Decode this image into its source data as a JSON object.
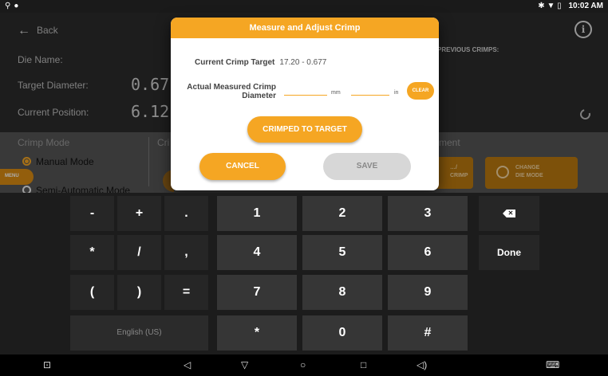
{
  "status_bar": {
    "left_icons": [
      "usb-icon",
      "location-icon"
    ],
    "right_icons": [
      "bluetooth-icon",
      "wifi-icon",
      "battery-icon"
    ],
    "time": "10:02 AM"
  },
  "app": {
    "back_label": "Back",
    "die_name_label": "Die Name:",
    "target_diameter_label": "Target Diameter:",
    "target_diameter_value": "0.67",
    "current_position_label": "Current Position:",
    "current_position_value": "6.12",
    "previous_crimps_label": "PREVIOUS CRIMPS:",
    "crimp_mode_title": "Crimp Mode",
    "manual_mode_label": "Manual Mode",
    "semi_auto_mode_label": "Semi-Automatic Mode",
    "menu_tab_label": "MENU",
    "partial_cri_label": "Cri",
    "partial_ment_label": "ment",
    "partial_crimp_button": "…/ \nCRIMP",
    "change_die_mode_button": "CHANGE\nDIE MODE"
  },
  "dialog": {
    "title": "Measure and Adjust Crimp",
    "current_target_label": "Current Crimp Target",
    "current_target_value": "17.20  -  0.677",
    "actual_measured_label": "Actual Measured Crimp Diameter",
    "mm_unit": "mm",
    "in_unit": "in",
    "mm_value": "",
    "in_value": "",
    "clear_label": "CLEAR",
    "crimped_to_target_label": "CRIMPED TO TARGET",
    "cancel_label": "CANCEL",
    "save_label": "SAVE"
  },
  "keyboard": {
    "row1": [
      "-",
      "+",
      ".",
      "1",
      "2",
      "3"
    ],
    "row2": [
      "*",
      "/",
      ",",
      "4",
      "5",
      "6",
      "Done"
    ],
    "row3": [
      "(",
      ")",
      "=",
      "7",
      "8",
      "9"
    ],
    "row4": [
      "English (US)",
      "*",
      "0",
      "#"
    ]
  },
  "navbar": {
    "icons": [
      "screenshot-icon",
      "volume-down-icon",
      "back-triangle-icon",
      "home-circle-icon",
      "recents-square-icon",
      "volume-up-icon",
      "keyboard-icon"
    ]
  }
}
